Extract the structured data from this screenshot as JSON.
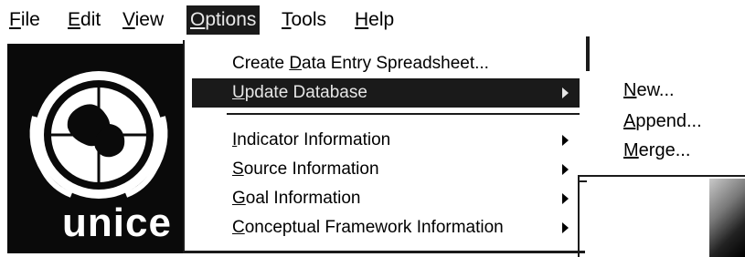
{
  "menubar": {
    "items": [
      {
        "pre": "",
        "ul": "F",
        "post": "ile"
      },
      {
        "pre": "",
        "ul": "E",
        "post": "dit"
      },
      {
        "pre": "",
        "ul": "V",
        "post": "iew"
      },
      {
        "pre": "",
        "ul": "O",
        "post": "ptions"
      },
      {
        "pre": "",
        "ul": "T",
        "post": "ools"
      },
      {
        "pre": "",
        "ul": "H",
        "post": "elp"
      }
    ]
  },
  "logo": {
    "text": "unice"
  },
  "options_menu": {
    "items": [
      {
        "pre": "Create ",
        "ul": "D",
        "post": "ata Entry Spreadsheet..."
      },
      {
        "pre": "",
        "ul": "U",
        "post": "pdate Database"
      },
      {
        "pre": "",
        "ul": "I",
        "post": "ndicator Information"
      },
      {
        "pre": "",
        "ul": "S",
        "post": "ource Information"
      },
      {
        "pre": "",
        "ul": "G",
        "post": "oal Information"
      },
      {
        "pre": "",
        "ul": "C",
        "post": "onceptual Framework Information"
      }
    ]
  },
  "update_submenu": {
    "items": [
      {
        "pre": "",
        "ul": "N",
        "post": "ew..."
      },
      {
        "pre": "",
        "ul": "A",
        "post": "ppend..."
      },
      {
        "pre": "",
        "ul": "M",
        "post": "erge..."
      }
    ]
  },
  "colors": {
    "highlight": "#1a1a1a",
    "highlight_text": "#e6e6e6"
  }
}
